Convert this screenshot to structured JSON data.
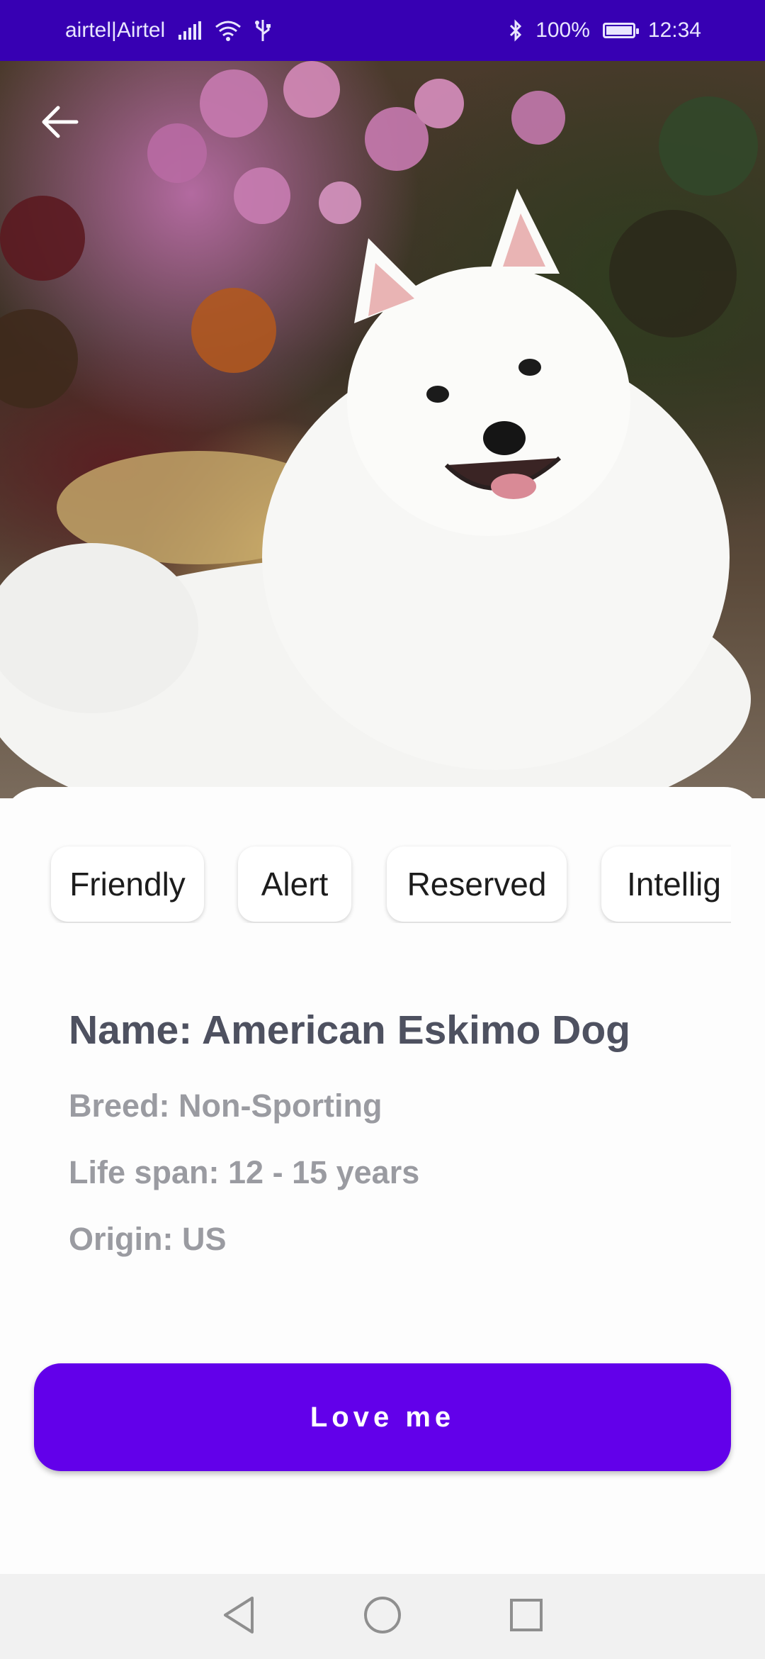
{
  "status_bar": {
    "carrier": "airtel|Airtel",
    "battery": "100%",
    "time": "12:34",
    "icons": [
      "signal-icon",
      "wifi-icon",
      "usb-icon",
      "bluetooth-icon",
      "battery-icon"
    ]
  },
  "hero": {
    "image": "white-dog-photo",
    "back_icon": "back-arrow-icon"
  },
  "temperament_chips": [
    "Friendly",
    "Alert",
    "Reserved",
    "Intellig"
  ],
  "details": {
    "name": "Name: American Eskimo Dog",
    "breed": "Breed: Non-Sporting",
    "life_span": "Life span: 12 - 15 years",
    "origin": "Origin: US"
  },
  "action": {
    "love_label": "Love me"
  },
  "nav": {
    "icons": [
      "back-triangle-icon",
      "home-circle-icon",
      "recents-square-icon"
    ]
  },
  "colors": {
    "status_bar": "#3700b3",
    "accent": "#6200ea"
  }
}
